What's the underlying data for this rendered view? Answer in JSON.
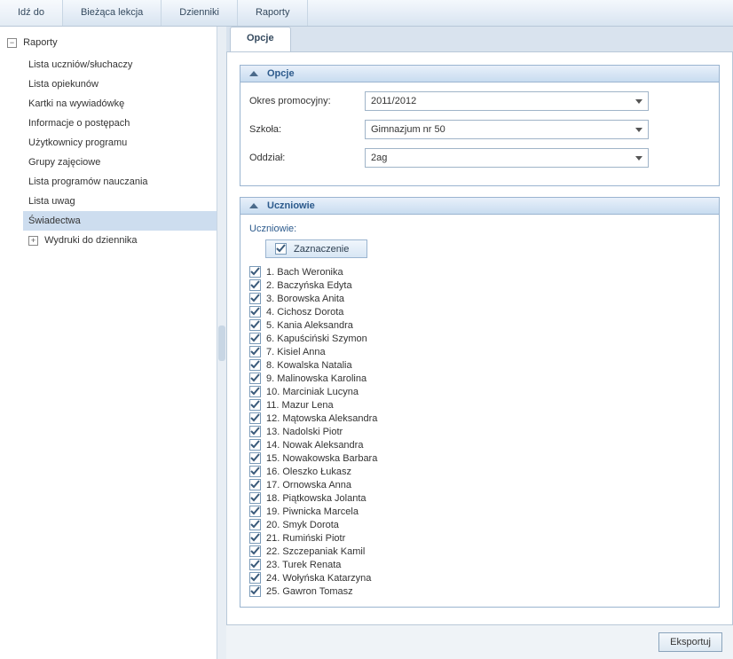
{
  "menu": {
    "items": [
      "Idź do",
      "Bieżąca lekcja",
      "Dzienniki",
      "Raporty"
    ]
  },
  "sidebar": {
    "root_label": "Raporty",
    "items": [
      {
        "label": "Lista uczniów/słuchaczy",
        "selected": false
      },
      {
        "label": "Lista opiekunów",
        "selected": false
      },
      {
        "label": "Kartki na wywiadówkę",
        "selected": false
      },
      {
        "label": "Informacje o postępach",
        "selected": false
      },
      {
        "label": "Użytkownicy programu",
        "selected": false
      },
      {
        "label": "Grupy zajęciowe",
        "selected": false
      },
      {
        "label": "Lista programów nauczania",
        "selected": false
      },
      {
        "label": "Lista uwag",
        "selected": false
      },
      {
        "label": "Świadectwa",
        "selected": true
      }
    ],
    "sub_root": "Wydruki do dziennika"
  },
  "tab": {
    "label": "Opcje"
  },
  "options_panel": {
    "title": "Opcje",
    "rows": [
      {
        "label": "Okres promocyjny:",
        "value": "2011/2012"
      },
      {
        "label": "Szkoła:",
        "value": "Gimnazjum nr 50"
      },
      {
        "label": "Oddział:",
        "value": "2ag"
      }
    ]
  },
  "students_panel": {
    "title": "Uczniowie",
    "label": "Uczniowie:",
    "select_all": "Zaznaczenie",
    "students": [
      "1. Bach Weronika",
      "2. Baczyńska Edyta",
      "3. Borowska Anita",
      "4. Cichosz Dorota",
      "5. Kania Aleksandra",
      "6. Kapuściński Szymon",
      "7. Kisiel Anna",
      "8. Kowalska Natalia",
      "9. Malinowska Karolina",
      "10. Marciniak Lucyna",
      "11. Mazur Lena",
      "12. Mątowska Aleksandra",
      "13. Nadolski Piotr",
      "14. Nowak Aleksandra",
      "15. Nowakowska Barbara",
      "16. Oleszko Łukasz",
      "17. Ornowska Anna",
      "18. Piątkowska Jolanta",
      "19. Piwnicka Marcela",
      "20. Smyk Dorota",
      "21. Rumiński Piotr",
      "22. Szczepaniak Kamil",
      "23. Turek Renata",
      "24. Wołyńska Katarzyna",
      "25. Gawron Tomasz"
    ]
  },
  "footer": {
    "export": "Eksportuj"
  }
}
